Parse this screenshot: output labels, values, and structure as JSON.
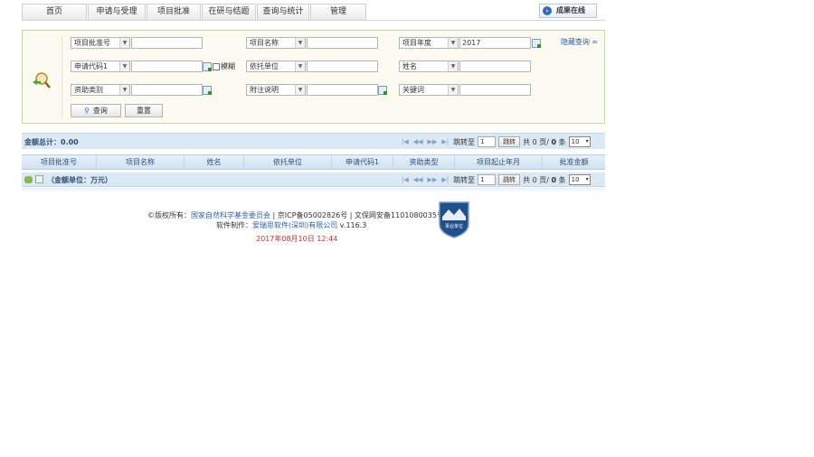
{
  "nav": {
    "tabs": [
      "首页",
      "申请与受理",
      "项目批准",
      "在研与结题",
      "查询与统计",
      "管理"
    ],
    "result_online": "成果在线"
  },
  "search": {
    "hide_link": "隐藏查询 ≈",
    "fields": {
      "f1": "项目批准号",
      "f2": "项目名称",
      "f3": "项目年度",
      "f3_value": "2017",
      "f4": "申请代码1",
      "fuzzy_label": "模糊",
      "f5": "依托单位",
      "f6": "姓名",
      "f7": "资助类别",
      "f8": "附注说明",
      "f9": "关键词"
    },
    "query_button": "查询",
    "reset_button": "重置"
  },
  "results": {
    "sum_label": "金额总计：0.00",
    "pager": {
      "goto_label": "跳转至",
      "page_value": "1",
      "goto_button": "跳转",
      "total_prefix": "共",
      "total_pages": "0",
      "pages_unit": "页/",
      "total_items": "0",
      "items_unit": "条",
      "page_size": "10"
    },
    "columns": [
      "项目批准号",
      "项目名称",
      "姓名",
      "依托单位",
      "申请代码1",
      "资助类型",
      "项目起止年月",
      "批准金额"
    ],
    "unit_label": "（金额单位：万元）"
  },
  "footer": {
    "copyright_prefix": "©版权所有：",
    "copyright_org": "国家自然科学基金委员会",
    "icp": " | 京ICP备05002826号 | 文保网安备1101080035号",
    "software_prefix": "软件制作：",
    "software_company": "爱瑞思软件(深圳)有限公司",
    "version": " v.116.3",
    "timestamp": "2017年08月10日 12:44",
    "badge_text": "事业单位"
  },
  "colors": {
    "accent": "#2d5fa6",
    "panel_border": "#c6d7a4",
    "panel_bg": "#fbfbf1",
    "bar_bg": "#dbe9f5",
    "timestamp": "#d03030"
  }
}
